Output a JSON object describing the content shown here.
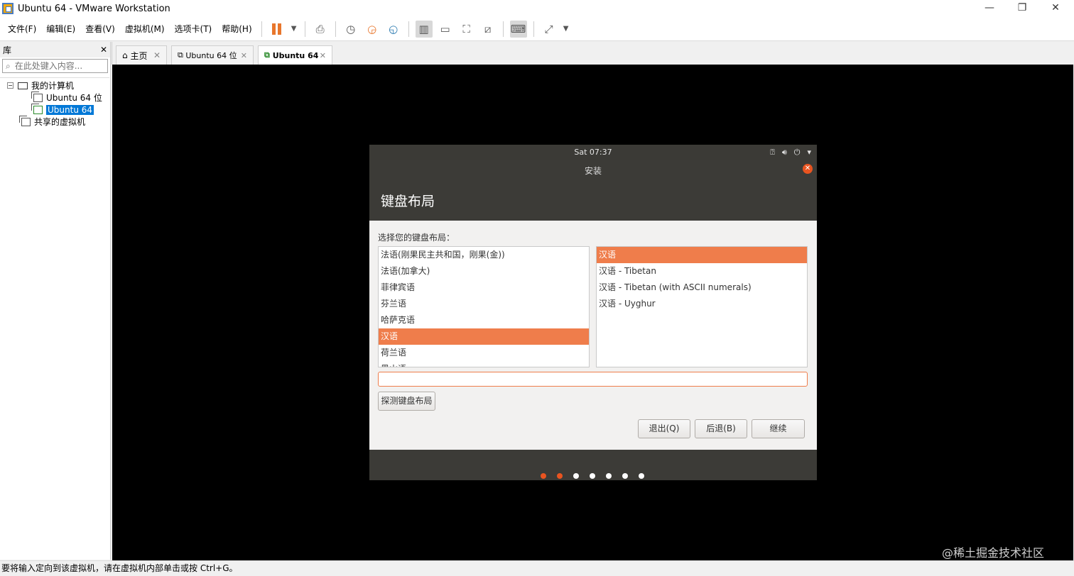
{
  "window": {
    "title": "Ubuntu 64  - VMware Workstation"
  },
  "menu": [
    "文件(F)",
    "编辑(E)",
    "查看(V)",
    "虚拟机(M)",
    "选项卡(T)",
    "帮助(H)"
  ],
  "library": {
    "title": "库",
    "search_placeholder": "在此处键入内容...",
    "tree": {
      "root": "我的计算机",
      "vm1": "Ubuntu 64 位",
      "vm2": "Ubuntu 64",
      "shared": "共享的虚拟机"
    }
  },
  "tabs": [
    {
      "label": "主页"
    },
    {
      "label": "Ubuntu 64 位"
    },
    {
      "label": "Ubuntu 64"
    }
  ],
  "ubuntu": {
    "clock": "Sat 07:37",
    "window_title": "安装",
    "heading": "键盘布局",
    "prompt": "选择您的键盘布局：",
    "layouts": [
      "法语(刚果民主共和国，刚果(金))",
      "法语(加拿大)",
      "菲律宾语",
      "芬兰语",
      "哈萨克语",
      "汉语",
      "荷兰语",
      "黑山语"
    ],
    "selected_layout": "汉语",
    "variants": [
      "汉语",
      "汉语 - Tibetan",
      "汉语 - Tibetan (with ASCII numerals)",
      "汉语 - Uyghur"
    ],
    "selected_variant": "汉语",
    "detect_button": "探测键盘布局",
    "quit_button": "退出(Q)",
    "back_button": "后退(B)",
    "continue_button": "继续",
    "progress": {
      "total_steps": 7,
      "current_step": 2
    }
  },
  "status_bar": {
    "message": "要将输入定向到该虚拟机，请在虚拟机内部单击或按 Ctrl+G。"
  },
  "watermark": "@稀土掘金技术社区",
  "colors": {
    "ubuntu_orange": "#e95420",
    "selection_orange": "#ef7d4b",
    "vmware_pause": "#e8762c",
    "tree_selection": "#0078d7"
  }
}
